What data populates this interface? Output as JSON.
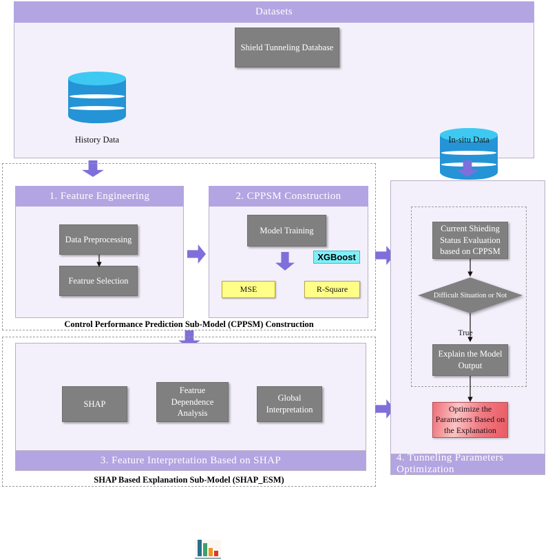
{
  "datasets": {
    "header": "Datasets",
    "database_box": "Shield Tunneling Database",
    "left_source_label": "History Data",
    "right_source_label": "In-situ Data"
  },
  "cppsm": {
    "caption": "Control Performance Prediction Sub-Model (CPPSM) Construction",
    "feature_engineering": {
      "header": "1. Feature Engineering",
      "step1": "Data Preprocessing",
      "step2": "Featrue Selection"
    },
    "construction": {
      "header": "2. CPPSM Construction",
      "model_training": "Model Training",
      "algorithm_badge": "XGBoost",
      "metric1": "MSE",
      "metric2": "R-Square"
    }
  },
  "shap_esm": {
    "caption": "SHAP Based Explanation Sub-Model (SHAP_ESM)",
    "footer_header": "3. Feature Interpretation Based on SHAP",
    "box1": "SHAP",
    "box2": "Featrue\nDependence\nAnalysis",
    "box2_lines": [
      "Featrue",
      "Dependence",
      "Analysis"
    ],
    "box3_lines": [
      "Global",
      "Interpretation"
    ]
  },
  "optimization": {
    "footer_header": "4. Tunneling Parameters Optimization",
    "evaluation_lines": [
      "Current Shieding",
      "Status Evaluation",
      "based on CPPSM"
    ],
    "decision": "Difficult Situation or Not",
    "decision_branch_label": "True",
    "explain_lines": [
      "Explain the Model",
      "Output"
    ],
    "optimize_lines": [
      "Optimize the",
      "Parameters Based on",
      "the Explanation"
    ]
  },
  "colors": {
    "header_purple": "#b3a4e2",
    "panel_fill": "#f4f0fb",
    "process_gray": "#808080",
    "metric_yellow": "#ffff88",
    "badge_cyan": "#7ff0f7",
    "arrow_purple": "#7f6fdb",
    "optimize_red": "#ea5a63",
    "db_blue": "#2494d6",
    "db_top_blue": "#3ec9f2"
  },
  "shap_icon": {
    "name": "bar-chart-icon",
    "bars": [
      {
        "color": "#2b6f8e",
        "height": 100
      },
      {
        "color": "#3f9e6e",
        "height": 78
      },
      {
        "color": "#f0921e",
        "height": 52
      },
      {
        "color": "#d8392b",
        "height": 34
      }
    ]
  }
}
